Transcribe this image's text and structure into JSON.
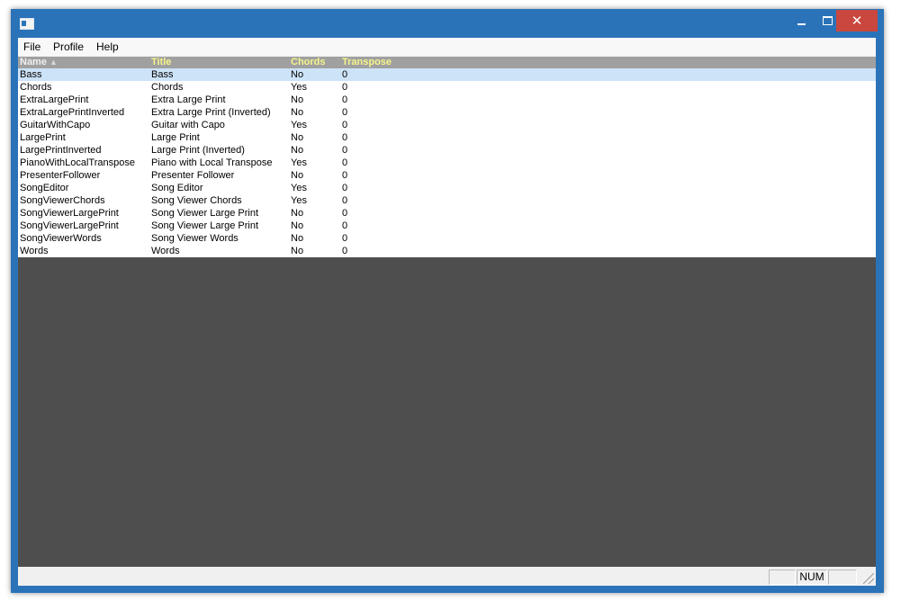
{
  "window": {
    "title": ""
  },
  "titlebar": {
    "close_glyph": "✕",
    "min_icon": "minimize-icon",
    "max_icon": "maximize-icon"
  },
  "menu": {
    "file": "File",
    "profile": "Profile",
    "help": "Help"
  },
  "columns": {
    "name": "Name",
    "sort": "▲",
    "title": "Title",
    "chords": "Chords",
    "transpose": "Transpose"
  },
  "rows": [
    {
      "name": "Bass",
      "title": "Bass",
      "chords": "No",
      "transpose": "0",
      "selected": true
    },
    {
      "name": "Chords",
      "title": "Chords",
      "chords": "Yes",
      "transpose": "0"
    },
    {
      "name": "ExtraLargePrint",
      "title": "Extra Large Print",
      "chords": "No",
      "transpose": "0"
    },
    {
      "name": "ExtraLargePrintInverted",
      "title": "Extra Large Print (Inverted)",
      "chords": "No",
      "transpose": "0"
    },
    {
      "name": "GuitarWithCapo",
      "title": "Guitar with Capo",
      "chords": "Yes",
      "transpose": "0"
    },
    {
      "name": "LargePrint",
      "title": "Large Print",
      "chords": "No",
      "transpose": "0"
    },
    {
      "name": "LargePrintInverted",
      "title": "Large Print (Inverted)",
      "chords": "No",
      "transpose": "0"
    },
    {
      "name": "PianoWithLocalTranspose",
      "title": "Piano with Local Transpose",
      "chords": "Yes",
      "transpose": "0"
    },
    {
      "name": "PresenterFollower",
      "title": "Presenter Follower",
      "chords": "No",
      "transpose": "0"
    },
    {
      "name": "SongEditor",
      "title": "Song Editor",
      "chords": "Yes",
      "transpose": "0"
    },
    {
      "name": "SongViewerChords",
      "title": "Song Viewer Chords",
      "chords": "Yes",
      "transpose": "0"
    },
    {
      "name": "SongViewerLargePrint",
      "title": "Song Viewer Large Print",
      "chords": "No",
      "transpose": "0"
    },
    {
      "name": "SongViewerLargePrint",
      "title": "Song Viewer Large Print",
      "chords": "No",
      "transpose": "0"
    },
    {
      "name": "SongViewerWords",
      "title": "Song Viewer Words",
      "chords": "No",
      "transpose": "0"
    },
    {
      "name": "Words",
      "title": "Words",
      "chords": "No",
      "transpose": "0"
    }
  ],
  "status": {
    "num": "NUM"
  },
  "colors": {
    "titlebar": "#2b73b8",
    "close": "#c9473f",
    "header_bg": "#a0a0a0",
    "header_text": "#f4f48c",
    "selection": "#cde3f8",
    "empty_area": "#4e4e4e"
  }
}
